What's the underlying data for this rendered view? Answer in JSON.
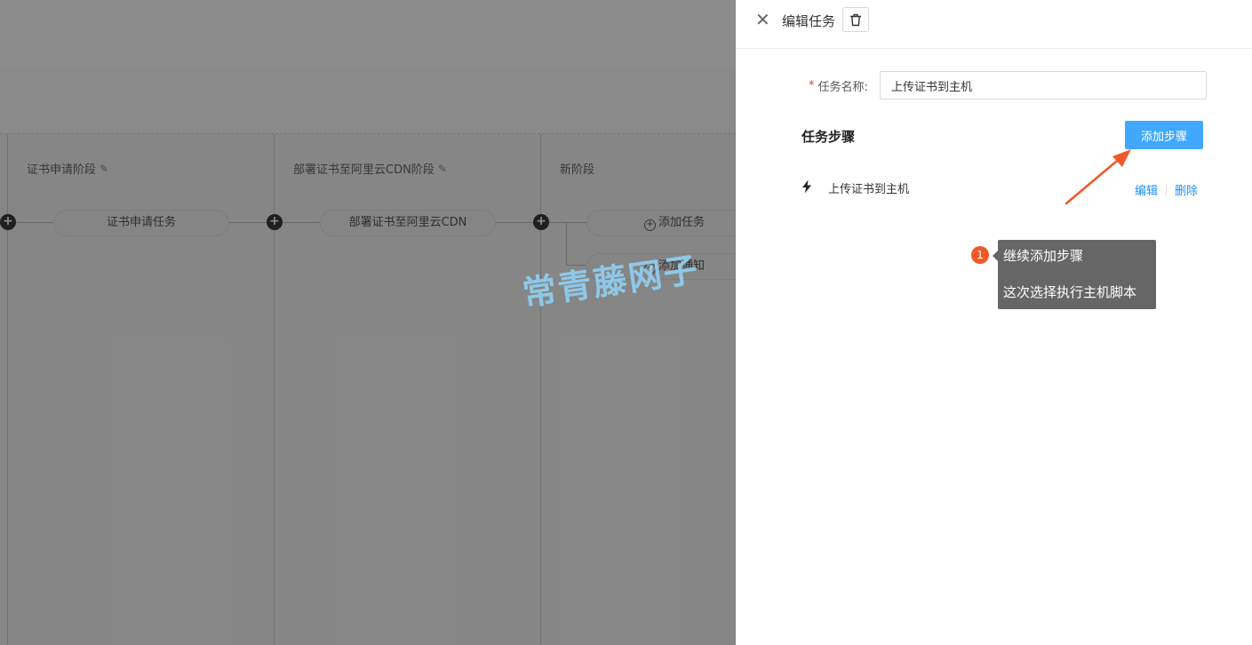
{
  "background": {
    "stages": [
      {
        "title": "证书申请阶段",
        "task": "证书申请任务"
      },
      {
        "title": "部署证书至阿里云CDN阶段",
        "task": "部署证书至阿里云CDN"
      },
      {
        "title": "新阶段",
        "add_task": "添加任务",
        "add_notify": "添加通知"
      }
    ]
  },
  "watermark": "常青藤网子",
  "drawer": {
    "title": "编辑任务",
    "form": {
      "name_label": "任务名称:",
      "required_mark": "*",
      "name_value": "上传证书到主机"
    },
    "steps_title": "任务步骤",
    "add_step_label": "添加步骤",
    "steps": [
      {
        "name": "上传证书到主机",
        "edit_label": "编辑",
        "delete_label": "删除"
      }
    ]
  },
  "annotation": {
    "badge": "1",
    "line1": "继续添加步骤",
    "line2": "这次选择执行主机脚本",
    "color": "#f05a28"
  },
  "colors": {
    "primary": "#40a9ff",
    "link": "#1890ff",
    "required": "#e53b3b"
  }
}
